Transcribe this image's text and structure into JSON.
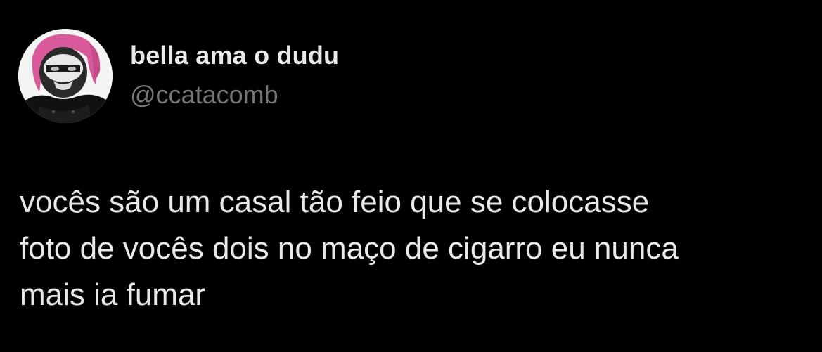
{
  "tweet": {
    "author": {
      "display_name": "bella ama o dudu",
      "handle": "@ccatacomb",
      "avatar_icon": "profile-photo-avatar"
    },
    "text": "vocês são um casal tão feio que se colocasse\nfoto de vocês dois no maço de cigarro eu nunca\nmais ia fumar"
  },
  "colors": {
    "background": "#000000",
    "primary_text": "#e7e9ea",
    "secondary_text": "#71767b"
  }
}
